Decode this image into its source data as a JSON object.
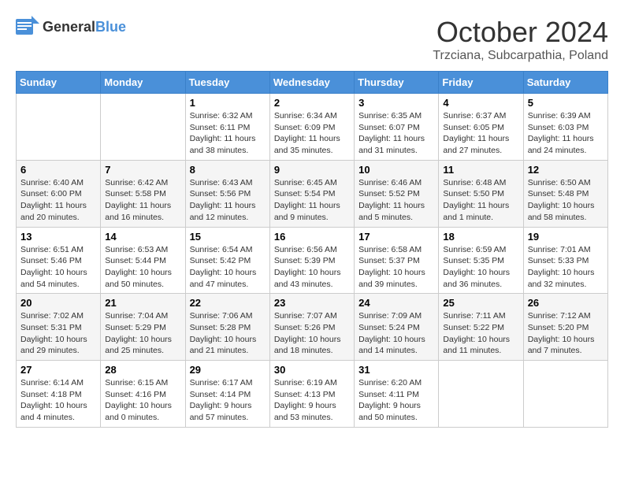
{
  "header": {
    "logo_general": "General",
    "logo_blue": "Blue",
    "month_title": "October 2024",
    "location": "Trzciana, Subcarpathia, Poland"
  },
  "weekdays": [
    "Sunday",
    "Monday",
    "Tuesday",
    "Wednesday",
    "Thursday",
    "Friday",
    "Saturday"
  ],
  "weeks": [
    [
      {
        "day": "",
        "sunrise": "",
        "sunset": "",
        "daylight": ""
      },
      {
        "day": "",
        "sunrise": "",
        "sunset": "",
        "daylight": ""
      },
      {
        "day": "1",
        "sunrise": "Sunrise: 6:32 AM",
        "sunset": "Sunset: 6:11 PM",
        "daylight": "Daylight: 11 hours and 38 minutes."
      },
      {
        "day": "2",
        "sunrise": "Sunrise: 6:34 AM",
        "sunset": "Sunset: 6:09 PM",
        "daylight": "Daylight: 11 hours and 35 minutes."
      },
      {
        "day": "3",
        "sunrise": "Sunrise: 6:35 AM",
        "sunset": "Sunset: 6:07 PM",
        "daylight": "Daylight: 11 hours and 31 minutes."
      },
      {
        "day": "4",
        "sunrise": "Sunrise: 6:37 AM",
        "sunset": "Sunset: 6:05 PM",
        "daylight": "Daylight: 11 hours and 27 minutes."
      },
      {
        "day": "5",
        "sunrise": "Sunrise: 6:39 AM",
        "sunset": "Sunset: 6:03 PM",
        "daylight": "Daylight: 11 hours and 24 minutes."
      }
    ],
    [
      {
        "day": "6",
        "sunrise": "Sunrise: 6:40 AM",
        "sunset": "Sunset: 6:00 PM",
        "daylight": "Daylight: 11 hours and 20 minutes."
      },
      {
        "day": "7",
        "sunrise": "Sunrise: 6:42 AM",
        "sunset": "Sunset: 5:58 PM",
        "daylight": "Daylight: 11 hours and 16 minutes."
      },
      {
        "day": "8",
        "sunrise": "Sunrise: 6:43 AM",
        "sunset": "Sunset: 5:56 PM",
        "daylight": "Daylight: 11 hours and 12 minutes."
      },
      {
        "day": "9",
        "sunrise": "Sunrise: 6:45 AM",
        "sunset": "Sunset: 5:54 PM",
        "daylight": "Daylight: 11 hours and 9 minutes."
      },
      {
        "day": "10",
        "sunrise": "Sunrise: 6:46 AM",
        "sunset": "Sunset: 5:52 PM",
        "daylight": "Daylight: 11 hours and 5 minutes."
      },
      {
        "day": "11",
        "sunrise": "Sunrise: 6:48 AM",
        "sunset": "Sunset: 5:50 PM",
        "daylight": "Daylight: 11 hours and 1 minute."
      },
      {
        "day": "12",
        "sunrise": "Sunrise: 6:50 AM",
        "sunset": "Sunset: 5:48 PM",
        "daylight": "Daylight: 10 hours and 58 minutes."
      }
    ],
    [
      {
        "day": "13",
        "sunrise": "Sunrise: 6:51 AM",
        "sunset": "Sunset: 5:46 PM",
        "daylight": "Daylight: 10 hours and 54 minutes."
      },
      {
        "day": "14",
        "sunrise": "Sunrise: 6:53 AM",
        "sunset": "Sunset: 5:44 PM",
        "daylight": "Daylight: 10 hours and 50 minutes."
      },
      {
        "day": "15",
        "sunrise": "Sunrise: 6:54 AM",
        "sunset": "Sunset: 5:42 PM",
        "daylight": "Daylight: 10 hours and 47 minutes."
      },
      {
        "day": "16",
        "sunrise": "Sunrise: 6:56 AM",
        "sunset": "Sunset: 5:39 PM",
        "daylight": "Daylight: 10 hours and 43 minutes."
      },
      {
        "day": "17",
        "sunrise": "Sunrise: 6:58 AM",
        "sunset": "Sunset: 5:37 PM",
        "daylight": "Daylight: 10 hours and 39 minutes."
      },
      {
        "day": "18",
        "sunrise": "Sunrise: 6:59 AM",
        "sunset": "Sunset: 5:35 PM",
        "daylight": "Daylight: 10 hours and 36 minutes."
      },
      {
        "day": "19",
        "sunrise": "Sunrise: 7:01 AM",
        "sunset": "Sunset: 5:33 PM",
        "daylight": "Daylight: 10 hours and 32 minutes."
      }
    ],
    [
      {
        "day": "20",
        "sunrise": "Sunrise: 7:02 AM",
        "sunset": "Sunset: 5:31 PM",
        "daylight": "Daylight: 10 hours and 29 minutes."
      },
      {
        "day": "21",
        "sunrise": "Sunrise: 7:04 AM",
        "sunset": "Sunset: 5:29 PM",
        "daylight": "Daylight: 10 hours and 25 minutes."
      },
      {
        "day": "22",
        "sunrise": "Sunrise: 7:06 AM",
        "sunset": "Sunset: 5:28 PM",
        "daylight": "Daylight: 10 hours and 21 minutes."
      },
      {
        "day": "23",
        "sunrise": "Sunrise: 7:07 AM",
        "sunset": "Sunset: 5:26 PM",
        "daylight": "Daylight: 10 hours and 18 minutes."
      },
      {
        "day": "24",
        "sunrise": "Sunrise: 7:09 AM",
        "sunset": "Sunset: 5:24 PM",
        "daylight": "Daylight: 10 hours and 14 minutes."
      },
      {
        "day": "25",
        "sunrise": "Sunrise: 7:11 AM",
        "sunset": "Sunset: 5:22 PM",
        "daylight": "Daylight: 10 hours and 11 minutes."
      },
      {
        "day": "26",
        "sunrise": "Sunrise: 7:12 AM",
        "sunset": "Sunset: 5:20 PM",
        "daylight": "Daylight: 10 hours and 7 minutes."
      }
    ],
    [
      {
        "day": "27",
        "sunrise": "Sunrise: 6:14 AM",
        "sunset": "Sunset: 4:18 PM",
        "daylight": "Daylight: 10 hours and 4 minutes."
      },
      {
        "day": "28",
        "sunrise": "Sunrise: 6:15 AM",
        "sunset": "Sunset: 4:16 PM",
        "daylight": "Daylight: 10 hours and 0 minutes."
      },
      {
        "day": "29",
        "sunrise": "Sunrise: 6:17 AM",
        "sunset": "Sunset: 4:14 PM",
        "daylight": "Daylight: 9 hours and 57 minutes."
      },
      {
        "day": "30",
        "sunrise": "Sunrise: 6:19 AM",
        "sunset": "Sunset: 4:13 PM",
        "daylight": "Daylight: 9 hours and 53 minutes."
      },
      {
        "day": "31",
        "sunrise": "Sunrise: 6:20 AM",
        "sunset": "Sunset: 4:11 PM",
        "daylight": "Daylight: 9 hours and 50 minutes."
      },
      {
        "day": "",
        "sunrise": "",
        "sunset": "",
        "daylight": ""
      },
      {
        "day": "",
        "sunrise": "",
        "sunset": "",
        "daylight": ""
      }
    ]
  ]
}
